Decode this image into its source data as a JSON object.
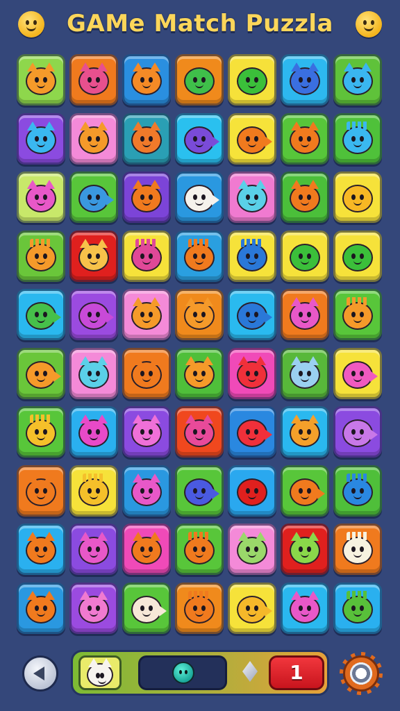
{
  "header": {
    "title": "GAMe Match Puzzla",
    "left_icon": "smiley-face-icon",
    "right_icon": "smiley-face-icon"
  },
  "board": {
    "rows": 10,
    "cols": 7,
    "tiles": [
      [
        {
          "bg": "#8ed74c",
          "c": "#f59a2a",
          "k": "cat"
        },
        {
          "bg": "#f07a1e",
          "c": "#e8508e",
          "k": "cat"
        },
        {
          "bg": "#2a8fe0",
          "c": "#f48a26",
          "k": "cat"
        },
        {
          "bg": "#f08a1c",
          "c": "#3fbf4a",
          "k": "blob"
        },
        {
          "bg": "#f6e13a",
          "c": "#3bbf3a",
          "k": "blob"
        },
        {
          "bg": "#2db8ef",
          "c": "#3a6fe0",
          "k": "cat"
        },
        {
          "bg": "#5fc23a",
          "c": "#3ab6f0",
          "k": "cat"
        }
      ],
      [
        {
          "bg": "#8b4be0",
          "c": "#3ab8f0",
          "k": "cat"
        },
        {
          "bg": "#f48ad8",
          "c": "#f59a2a",
          "k": "cat"
        },
        {
          "bg": "#2a9fb4",
          "c": "#f07a2a",
          "k": "cat"
        },
        {
          "bg": "#2ac0ef",
          "c": "#7a4bd8",
          "k": "fish"
        },
        {
          "bg": "#f6e33a",
          "c": "#f07a1e",
          "k": "fish"
        },
        {
          "bg": "#57c63a",
          "c": "#f07a1e",
          "k": "cat"
        },
        {
          "bg": "#4fc13a",
          "c": "#3ab8f0",
          "k": "spiky"
        }
      ],
      [
        {
          "bg": "#c8e86a",
          "c": "#e858c8",
          "k": "cat"
        },
        {
          "bg": "#58c63a",
          "c": "#3a98e0",
          "k": "fish"
        },
        {
          "bg": "#7c44d8",
          "c": "#f07a1e",
          "k": "cat"
        },
        {
          "bg": "#2a98e0",
          "c": "#f5f2ec",
          "k": "fish"
        },
        {
          "bg": "#f07ad0",
          "c": "#5ad0e8",
          "k": "cat"
        },
        {
          "bg": "#4bbf3a",
          "c": "#f07a1e",
          "k": "cat"
        },
        {
          "bg": "#f6e23a",
          "c": "#f7b824",
          "k": "blob"
        }
      ],
      [
        {
          "bg": "#6ac63a",
          "c": "#f59a2a",
          "k": "spiky"
        },
        {
          "bg": "#e0201e",
          "c": "#f7c24a",
          "k": "cat"
        },
        {
          "bg": "#f6e23a",
          "c": "#e04898",
          "k": "spiky"
        },
        {
          "bg": "#2a9fe0",
          "c": "#f07a1e",
          "k": "spiky"
        },
        {
          "bg": "#f6e23a",
          "c": "#2a78d8",
          "k": "spiky"
        },
        {
          "bg": "#f6e23a",
          "c": "#3bbf3a",
          "k": "blob"
        },
        {
          "bg": "#f6e23a",
          "c": "#3bbf3a",
          "k": "blob"
        }
      ],
      [
        {
          "bg": "#2ab8ef",
          "c": "#46c04a",
          "k": "fish"
        },
        {
          "bg": "#9b4be0",
          "c": "#c84ad8",
          "k": "fish"
        },
        {
          "bg": "#f48ad8",
          "c": "#f59a2a",
          "k": "cat"
        },
        {
          "bg": "#f08a1c",
          "c": "#f59a2a",
          "k": "cat"
        },
        {
          "bg": "#2abaef",
          "c": "#2a78d8",
          "k": "fish"
        },
        {
          "bg": "#f07a1e",
          "c": "#e858c8",
          "k": "cat"
        },
        {
          "bg": "#58c63a",
          "c": "#f59a2a",
          "k": "spiky"
        }
      ],
      [
        {
          "bg": "#6ac63a",
          "c": "#f59a2a",
          "k": "fish"
        },
        {
          "bg": "#f48ad8",
          "c": "#5ad0e8",
          "k": "cat"
        },
        {
          "bg": "#f07a1e",
          "c": "#f07a1e",
          "k": "cat"
        },
        {
          "bg": "#4fbf3a",
          "c": "#f59a2a",
          "k": "cat"
        },
        {
          "bg": "#f04ab8",
          "c": "#f0303a",
          "k": "cat"
        },
        {
          "bg": "#58b83a",
          "c": "#9ad0f0",
          "k": "cat"
        },
        {
          "bg": "#f6e23a",
          "c": "#f05ac0",
          "k": "fish"
        }
      ],
      [
        {
          "bg": "#58c63a",
          "c": "#f5c02a",
          "k": "spiky"
        },
        {
          "bg": "#2ab0ef",
          "c": "#e84ac8",
          "k": "cat"
        },
        {
          "bg": "#8b4be0",
          "c": "#f070d8",
          "k": "cat"
        },
        {
          "bg": "#f0481e",
          "c": "#e84a9a",
          "k": "cat"
        },
        {
          "bg": "#2a88e0",
          "c": "#f0303a",
          "k": "fish"
        },
        {
          "bg": "#2ab8ef",
          "c": "#f5a02a",
          "k": "cat"
        },
        {
          "bg": "#8b4be0",
          "c": "#c878e8",
          "k": "fish"
        }
      ],
      [
        {
          "bg": "#f07a1e",
          "c": "#f07a1e",
          "k": "cat"
        },
        {
          "bg": "#f6e23a",
          "c": "#f5c02a",
          "k": "spiky"
        },
        {
          "bg": "#2a98e0",
          "c": "#e858c8",
          "k": "cat"
        },
        {
          "bg": "#58c63a",
          "c": "#4a5ae0",
          "k": "fish"
        },
        {
          "bg": "#2aa8ef",
          "c": "#e0201e",
          "k": "blob"
        },
        {
          "bg": "#58c63a",
          "c": "#f07a1e",
          "k": "fish"
        },
        {
          "bg": "#4fbf3a",
          "c": "#2a88e0",
          "k": "spiky"
        }
      ],
      [
        {
          "bg": "#2ab0ef",
          "c": "#f07a1e",
          "k": "cat"
        },
        {
          "bg": "#8b4be0",
          "c": "#e858c8",
          "k": "cat"
        },
        {
          "bg": "#f04ab8",
          "c": "#f07a1e",
          "k": "cat"
        },
        {
          "bg": "#58c63a",
          "c": "#f07a1e",
          "k": "spiky"
        },
        {
          "bg": "#f48ad8",
          "c": "#9ad86a",
          "k": "cat"
        },
        {
          "bg": "#e0201e",
          "c": "#8ad84a",
          "k": "cat"
        },
        {
          "bg": "#f07a1e",
          "c": "#f7f2e0",
          "k": "spiky"
        }
      ],
      [
        {
          "bg": "#2a98e0",
          "c": "#f07a1e",
          "k": "cat"
        },
        {
          "bg": "#9b4be0",
          "c": "#f07ad0",
          "k": "cat"
        },
        {
          "bg": "#58c63a",
          "c": "#f7e8d8",
          "k": "fish"
        },
        {
          "bg": "#f08a1c",
          "c": "#f07a1e",
          "k": "spiky"
        },
        {
          "bg": "#f6e23a",
          "c": "#f5b82a",
          "k": "fish"
        },
        {
          "bg": "#2ab8ef",
          "c": "#e858c8",
          "k": "cat"
        },
        {
          "bg": "#2ab0ef",
          "c": "#58c03a",
          "k": "spiky"
        }
      ]
    ]
  },
  "bottom_bar": {
    "back_icon": "back-arrow-icon",
    "selected_tile_icon": "white-cat-icon",
    "target_icon": "teal-creature-icon",
    "gem_icon": "diamond-icon",
    "counter_value": "1",
    "settings_icon": "gear-icon",
    "colors": {
      "counter": "#e0202a",
      "bar_left": "#7dbb34",
      "bar_right": "#e6a13a"
    }
  }
}
